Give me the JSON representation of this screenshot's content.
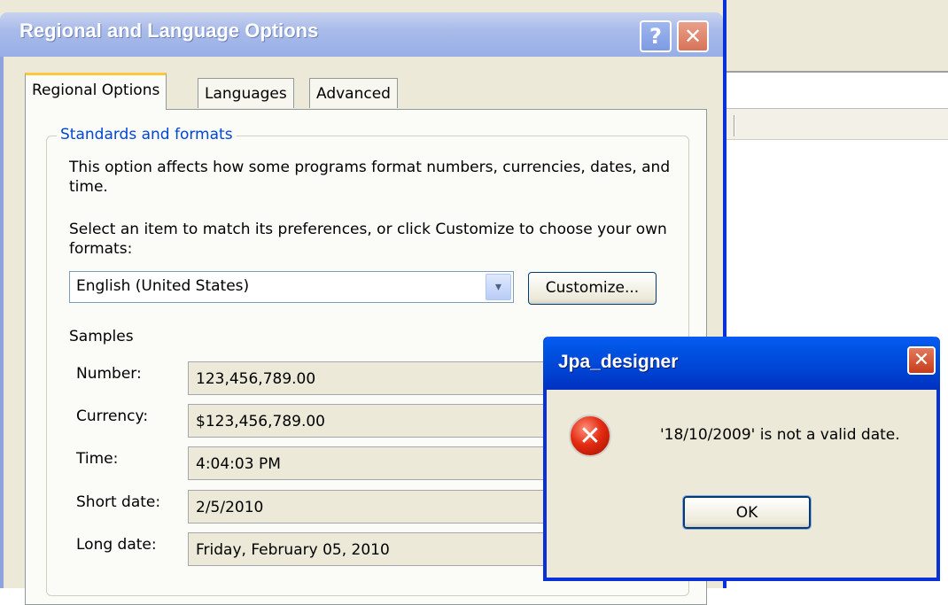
{
  "main_dialog": {
    "title": "Regional and Language Options",
    "help_label": "?",
    "close_label": "✕",
    "tabs": [
      {
        "label": "Regional Options"
      },
      {
        "label": "Languages"
      },
      {
        "label": "Advanced"
      }
    ],
    "group_title": "Standards and formats",
    "description1": "This option affects how some programs format numbers, currencies, dates, and time.",
    "description2": "Select an item to match its preferences, or click Customize to choose your own formats:",
    "locale_select": {
      "value": "English (United States)",
      "arrow": "▾"
    },
    "customize_label": "Customize...",
    "samples_label": "Samples",
    "samples": [
      {
        "label": "Number:",
        "value": "123,456,789.00"
      },
      {
        "label": "Currency:",
        "value": "$123,456,789.00"
      },
      {
        "label": "Time:",
        "value": "4:04:03 PM"
      },
      {
        "label": "Short date:",
        "value": "2/5/2010"
      },
      {
        "label": "Long date:",
        "value": "Friday, February 05, 2010"
      }
    ]
  },
  "message_box": {
    "title": "Jpa_designer",
    "close_label": "✕",
    "icon": "error-icon",
    "icon_glyph": "✕",
    "message": "'18/10/2009' is not a valid date.",
    "ok_label": "OK"
  },
  "colors": {
    "xp_blue": "#0831d9",
    "dialog_face": "#ece9d8",
    "group_title": "#0046d5",
    "tab_highlight": "#ffc83c"
  }
}
